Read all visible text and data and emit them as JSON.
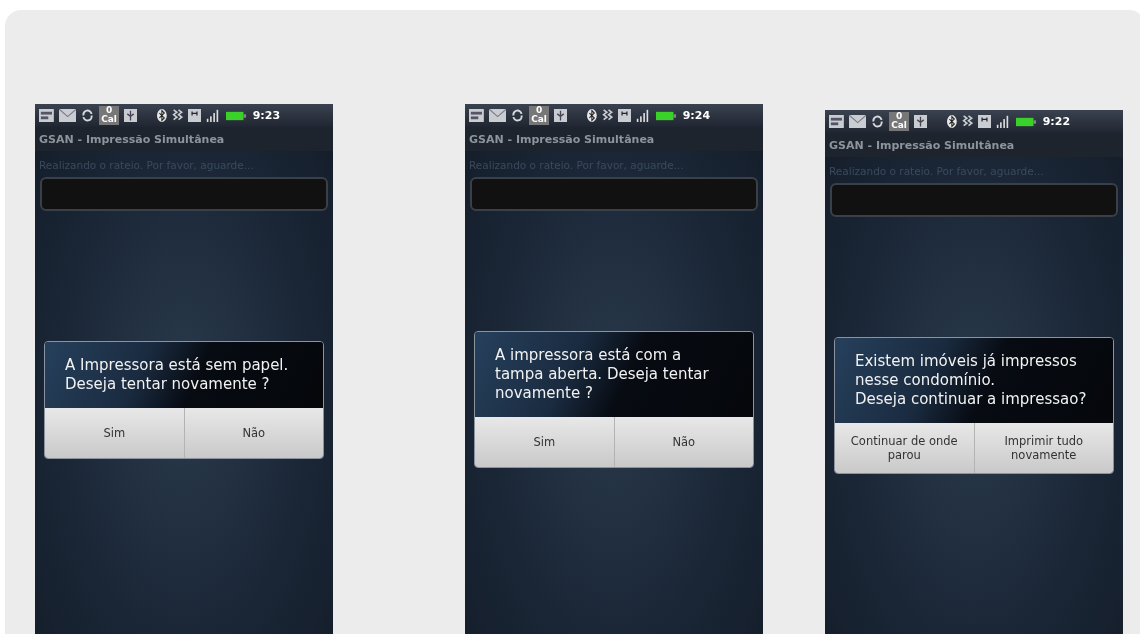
{
  "phones": [
    {
      "status_bar": {
        "calendar_count": "0",
        "calendar_label": "Cal",
        "time": "9:23"
      },
      "title": "GSAN - Impressão Simultânea",
      "status_text": "Realizando o rateio. Por favor, aguarde...",
      "progress": {
        "level": 0
      },
      "dialog": {
        "message": "A Impressora está sem papel.\nDeseja tentar novamente ?",
        "buttons": [
          "Sim",
          "Não"
        ]
      }
    },
    {
      "status_bar": {
        "calendar_count": "0",
        "calendar_label": "Cal",
        "time": "9:24"
      },
      "title": "GSAN - Impressão Simultânea",
      "status_text": "Realizando o rateio. Por favor, aguarde...",
      "progress": {
        "level": 0
      },
      "dialog": {
        "message": "A impressora está com a\ntampa aberta. Deseja tentar\nnovamente ?",
        "buttons": [
          "Sim",
          "Não"
        ]
      }
    },
    {
      "status_bar": {
        "calendar_count": "0",
        "calendar_label": "Cal",
        "time": "9:22"
      },
      "title": "GSAN - Impressão Simultânea",
      "status_text": "Realizando o rateio. Por favor, aguarde...",
      "progress": {
        "level": 0
      },
      "dialog": {
        "message": "Existem imóveis já impressos\nnesse condomínio.\nDeseja continuar a impressao?",
        "buttons": [
          "Continuar de onde\nparou",
          "Imprimir tudo\nnovamente"
        ]
      }
    }
  ]
}
